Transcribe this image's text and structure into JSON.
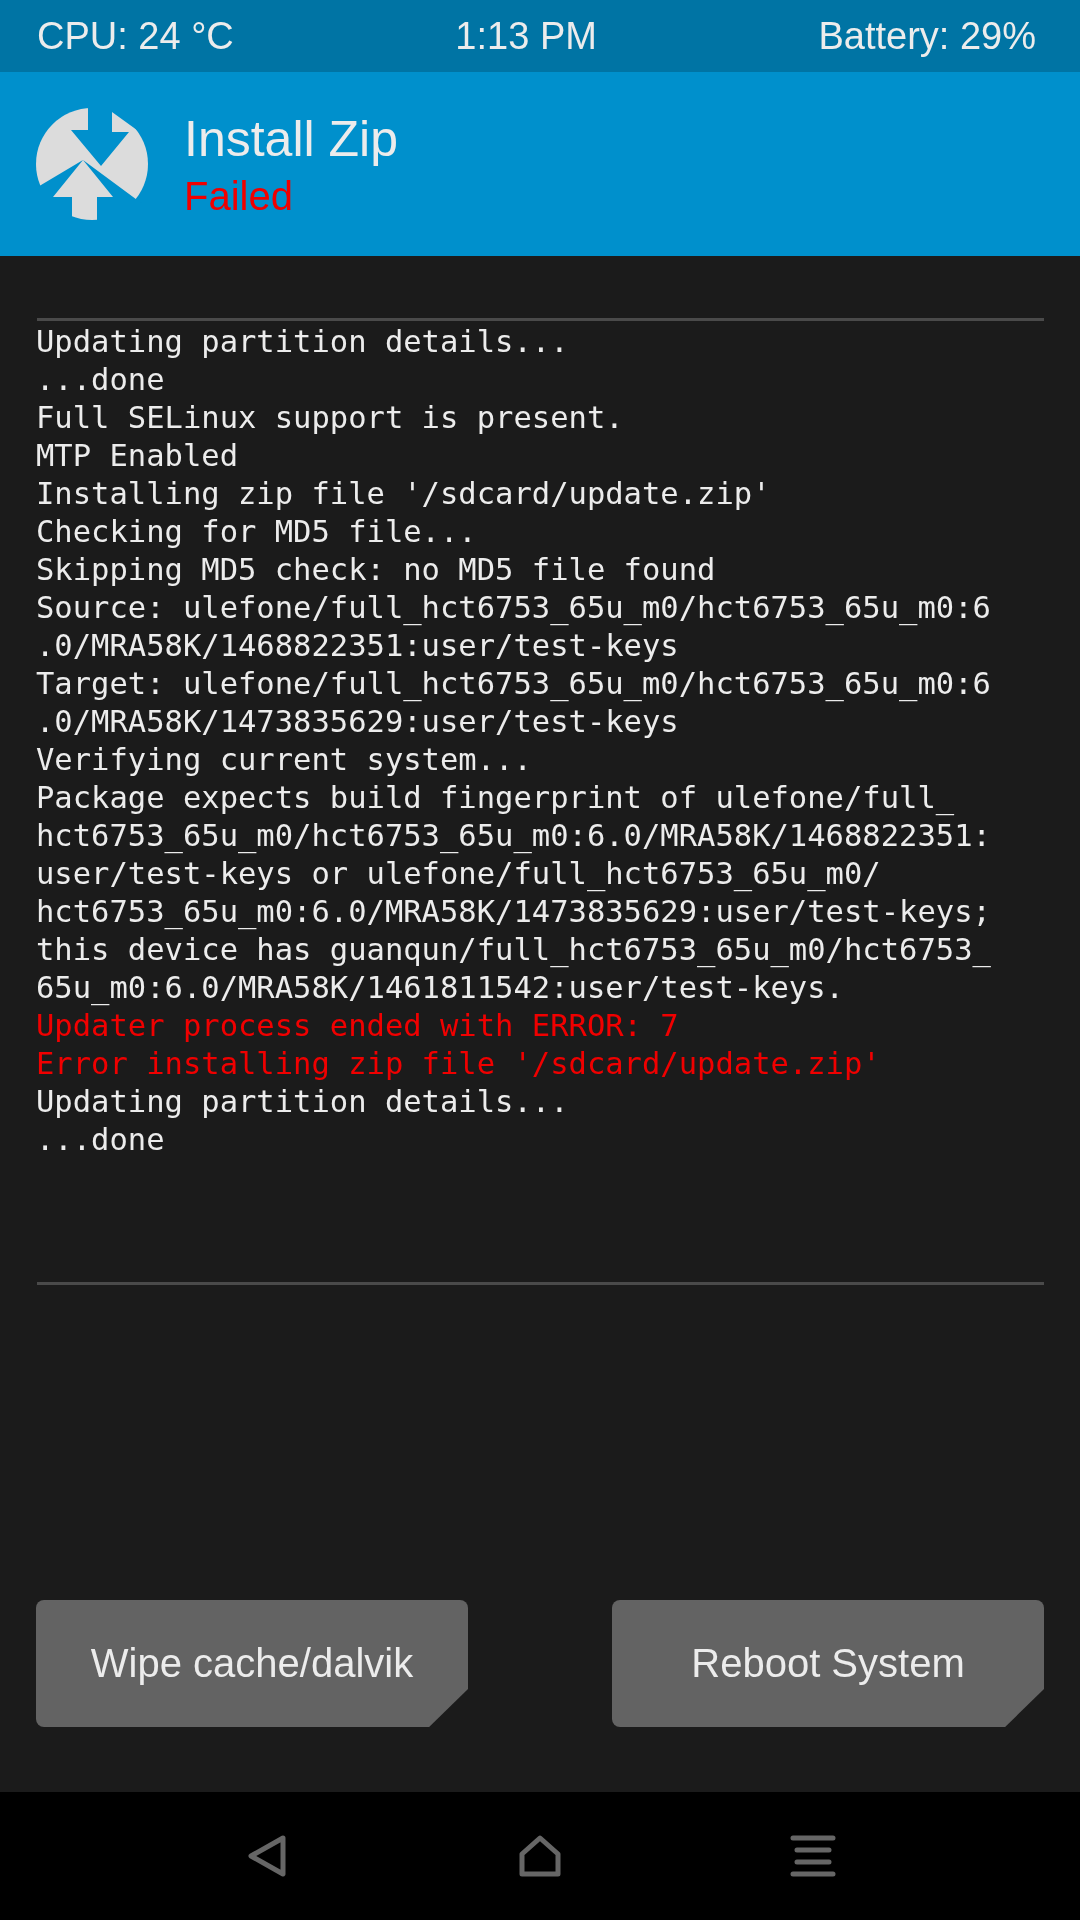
{
  "status_bar": {
    "cpu": "CPU: 24 °C",
    "time": "1:13 PM",
    "battery": "Battery: 29%"
  },
  "header": {
    "title": "Install Zip",
    "status": "Failed"
  },
  "log": [
    {
      "kind": "normal",
      "text": "Updating partition details..."
    },
    {
      "kind": "normal",
      "text": "...done"
    },
    {
      "kind": "normal",
      "text": "Full SELinux support is present."
    },
    {
      "kind": "normal",
      "text": "MTP Enabled"
    },
    {
      "kind": "normal",
      "text": "Installing zip file '/sdcard/update.zip'"
    },
    {
      "kind": "normal",
      "text": "Checking for MD5 file..."
    },
    {
      "kind": "normal",
      "text": "Skipping MD5 check: no MD5 file found"
    },
    {
      "kind": "normal",
      "text": "Source: ulefone/full_hct6753_65u_m0/hct6753_65u_m0:6"
    },
    {
      "kind": "normal",
      "text": ".0/MRA58K/1468822351:user/test-keys"
    },
    {
      "kind": "normal",
      "text": "Target: ulefone/full_hct6753_65u_m0/hct6753_65u_m0:6"
    },
    {
      "kind": "normal",
      "text": ".0/MRA58K/1473835629:user/test-keys"
    },
    {
      "kind": "normal",
      "text": "Verifying current system..."
    },
    {
      "kind": "normal",
      "text": "Package expects build fingerprint of ulefone/full_"
    },
    {
      "kind": "normal",
      "text": "hct6753_65u_m0/hct6753_65u_m0:6.0/MRA58K/1468822351:"
    },
    {
      "kind": "normal",
      "text": "user/test-keys or ulefone/full_hct6753_65u_m0/"
    },
    {
      "kind": "normal",
      "text": "hct6753_65u_m0:6.0/MRA58K/1473835629:user/test-keys;"
    },
    {
      "kind": "normal",
      "text": "this device has guanqun/full_hct6753_65u_m0/hct6753_"
    },
    {
      "kind": "normal",
      "text": "65u_m0:6.0/MRA58K/1461811542:user/test-keys."
    },
    {
      "kind": "error",
      "text": "Updater process ended with ERROR: 7"
    },
    {
      "kind": "error",
      "text": "Error installing zip file '/sdcard/update.zip'"
    },
    {
      "kind": "normal",
      "text": "Updating partition details..."
    },
    {
      "kind": "normal",
      "text": "...done"
    }
  ],
  "buttons": [
    "Wipe cache/dalvik",
    "Reboot System"
  ]
}
